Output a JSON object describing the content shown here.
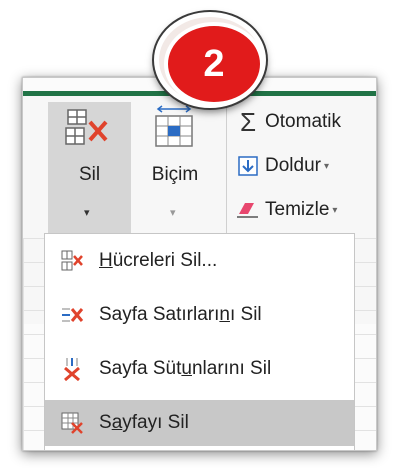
{
  "step_badge": "2",
  "ribbon": {
    "sil_label": "Sil",
    "bicim_label": "Biçim",
    "dropdown_arrow": "▾",
    "otomatik_label": "Otomatik",
    "doldur_label": "Doldur",
    "temizle_label": "Temizle"
  },
  "menu": {
    "items": [
      {
        "pre": "",
        "ul": "H",
        "post": "ücreleri Sil...",
        "icon": "delete-cells-icon"
      },
      {
        "pre": "Sayfa Satırları",
        "ul": "n",
        "post": "ı Sil",
        "icon": "delete-rows-icon"
      },
      {
        "pre": "Sayfa Süt",
        "ul": "u",
        "post": "nlarını Sil",
        "icon": "delete-columns-icon"
      },
      {
        "pre": "S",
        "ul": "a",
        "post": "yfayı Sil",
        "icon": "delete-sheet-icon"
      }
    ],
    "highlighted_index": 3
  },
  "colors": {
    "excel_green": "#217346",
    "delete_red": "#e0432c",
    "badge_red": "#e11b1b"
  }
}
